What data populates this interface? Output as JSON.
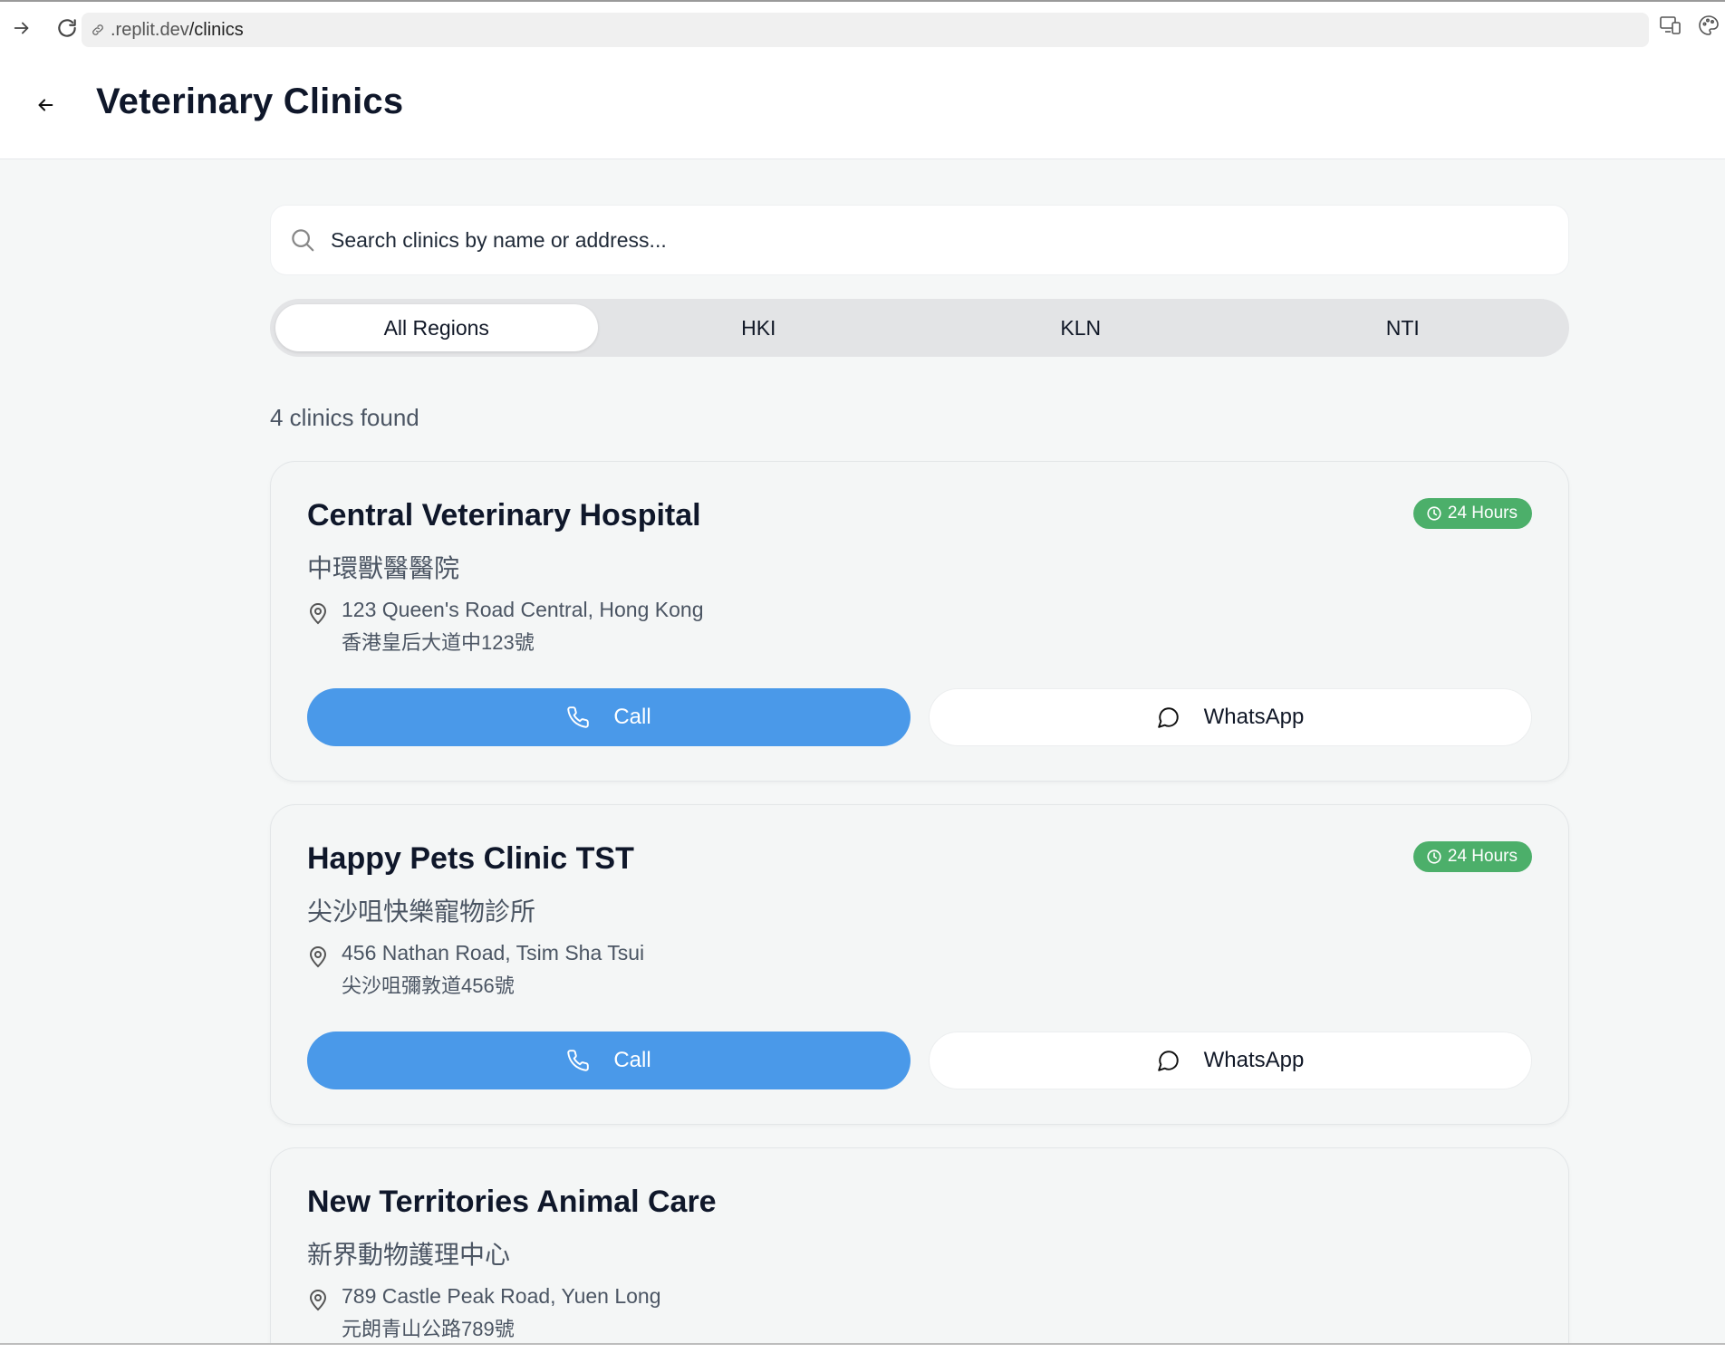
{
  "browser": {
    "url_host": ".replit.dev",
    "url_path": "/clinics"
  },
  "header": {
    "title": "Veterinary Clinics"
  },
  "search": {
    "placeholder": "Search clinics by name or address...",
    "value": ""
  },
  "tabs": [
    {
      "label": "All Regions",
      "active": true
    },
    {
      "label": "HKI",
      "active": false
    },
    {
      "label": "KLN",
      "active": false
    },
    {
      "label": "NTI",
      "active": false
    }
  ],
  "results": {
    "count_text": "4 clinics found"
  },
  "clinics": [
    {
      "name": "Central Veterinary Hospital",
      "name_zh": "中環獸醫醫院",
      "badge": "24 Hours",
      "address_en": "123 Queen's Road Central, Hong Kong",
      "address_zh": "香港皇后大道中123號",
      "call_label": "Call",
      "whatsapp_label": "WhatsApp"
    },
    {
      "name": "Happy Pets Clinic TST",
      "name_zh": "尖沙咀快樂寵物診所",
      "badge": "24 Hours",
      "address_en": "456 Nathan Road, Tsim Sha Tsui",
      "address_zh": "尖沙咀彌敦道456號",
      "call_label": "Call",
      "whatsapp_label": "WhatsApp"
    },
    {
      "name": "New Territories Animal Care",
      "name_zh": "新界動物護理中心",
      "address_en": "789 Castle Peak Road, Yuen Long",
      "address_zh": "元朗青山公路789號"
    }
  ],
  "colors": {
    "primary": "#4a99e9",
    "badge": "#4caf6a",
    "page_bg": "#f5f7f7"
  }
}
